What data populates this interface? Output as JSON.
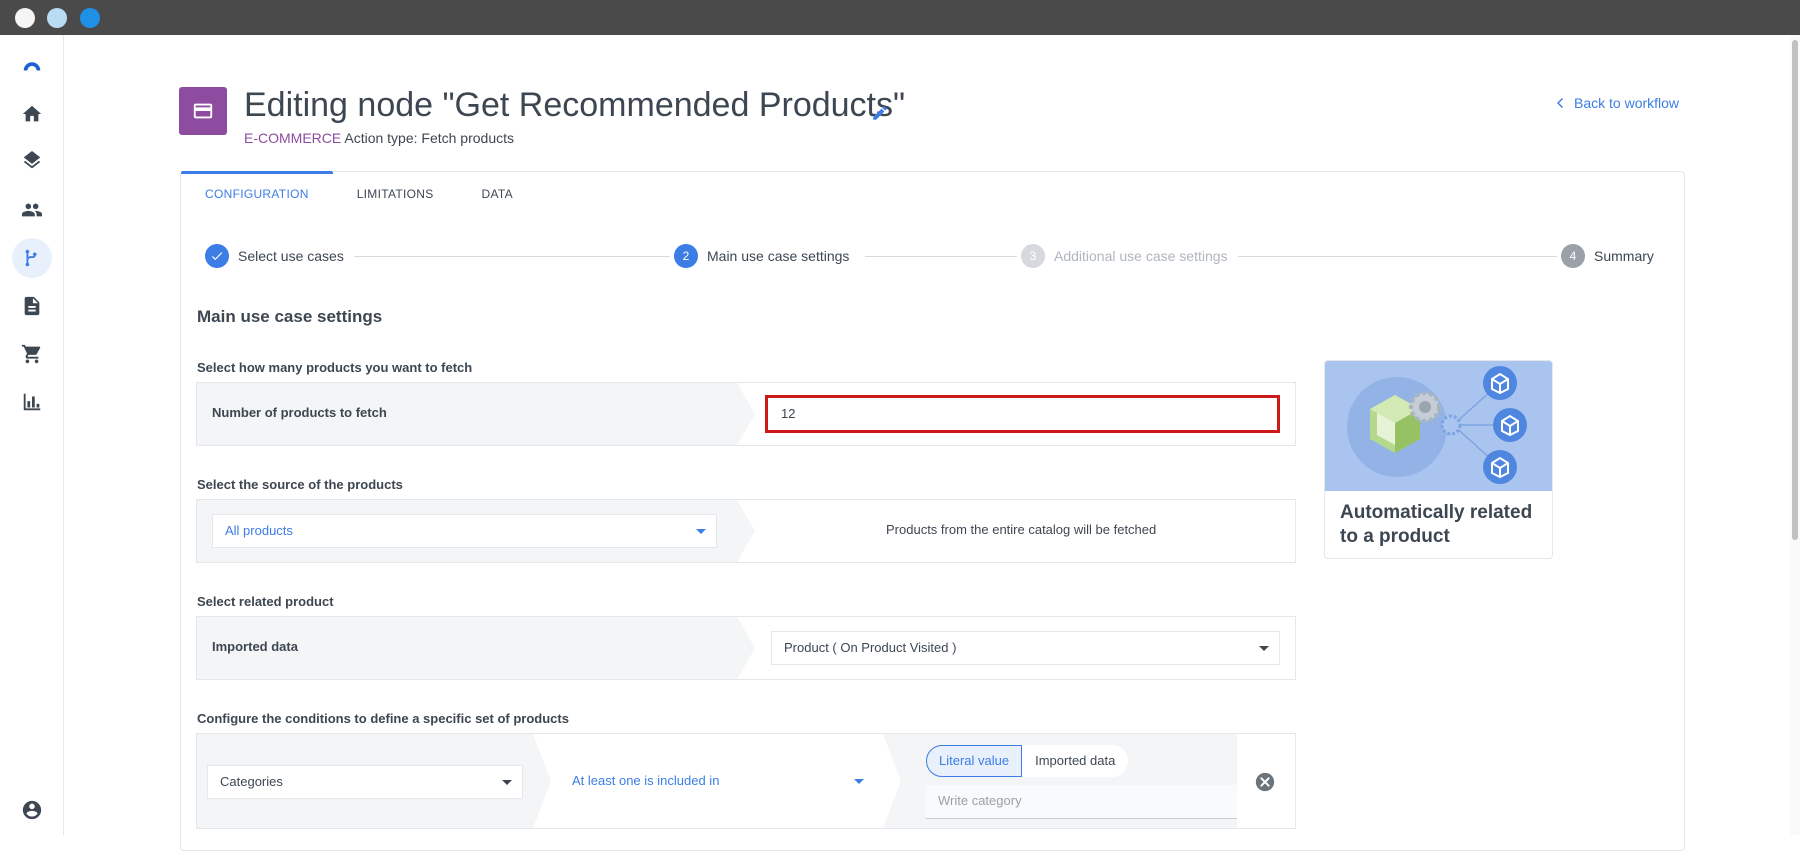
{
  "header": {
    "title": "Editing node \"Get Recommended Products\"",
    "category": "E-COMMERCE",
    "action_type": "Action type: Fetch products",
    "back_label": "Back to workflow"
  },
  "tabs": [
    {
      "label": "CONFIGURATION",
      "active": true
    },
    {
      "label": "LIMITATIONS",
      "active": false
    },
    {
      "label": "DATA",
      "active": false
    }
  ],
  "stepper": {
    "steps": [
      {
        "number": "",
        "label": "Select use cases",
        "state": "done"
      },
      {
        "number": "2",
        "label": "Main use case settings",
        "state": "current"
      },
      {
        "number": "3",
        "label": "Additional use case settings",
        "state": "future"
      },
      {
        "number": "4",
        "label": "Summary",
        "state": "future"
      }
    ]
  },
  "main": {
    "section_title": "Main use case settings",
    "fetch_count": {
      "question": "Select how many products you want to fetch",
      "row_label": "Number of products to fetch",
      "value": "12"
    },
    "source": {
      "question": "Select the source of the products",
      "selected": "All products",
      "info": "Products from the entire catalog will be fetched"
    },
    "related": {
      "question": "Select related product",
      "row_label": "Imported data",
      "selected": "Product ( On Product Visited )"
    },
    "conditions": {
      "question": "Configure the conditions to define a specific set of products",
      "attribute": "Categories",
      "operator": "At least one is included in",
      "toggle_literal": "Literal value",
      "toggle_imported": "Imported data",
      "placeholder": "Write category"
    }
  },
  "illustration": {
    "title": "Automatically related to a product"
  },
  "colors": {
    "accent": "#3c7de6",
    "node_badge": "#8d4c9f",
    "highlight_border": "#cc1a1a"
  }
}
